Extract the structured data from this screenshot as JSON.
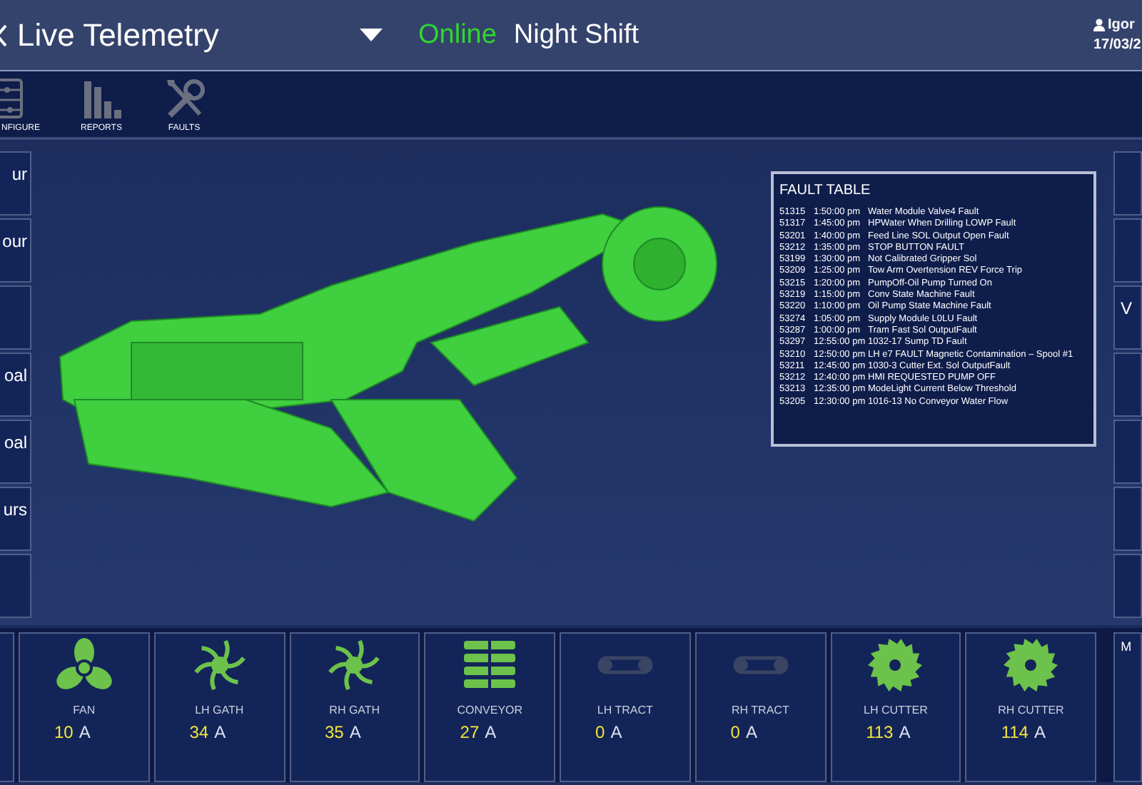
{
  "header": {
    "title": "Live Telemetry",
    "connection": "Online",
    "shift": "Night Shift",
    "user": "Igor",
    "date": "17/03/2"
  },
  "toolbar": [
    {
      "kind": "configure",
      "label": "NFIGURE"
    },
    {
      "kind": "reports",
      "label": "REPORTS"
    },
    {
      "kind": "faults",
      "label": "FAULTS"
    }
  ],
  "left_buttons": [
    {
      "kind": "text",
      "label": "ur"
    },
    {
      "kind": "text",
      "label": "our"
    },
    {
      "kind": "blank"
    },
    {
      "kind": "text",
      "label": "oal"
    },
    {
      "kind": "text",
      "label": "oal"
    },
    {
      "kind": "text",
      "label": "urs"
    },
    {
      "kind": "blank"
    }
  ],
  "right_buttons": [
    {
      "kind": "blank"
    },
    {
      "kind": "blank"
    },
    {
      "kind": "text",
      "label": "V"
    },
    {
      "kind": "blank"
    },
    {
      "kind": "blank"
    },
    {
      "kind": "blank"
    },
    {
      "kind": "blank"
    }
  ],
  "fault_table": {
    "title": "FAULT TABLE",
    "rows": [
      {
        "code": "51315",
        "time": "1:50:00 pm",
        "description": "Water Module Valve4 Fault"
      },
      {
        "code": "51317",
        "time": "1:45:00 pm",
        "description": "HPWater When Drilling LOWP Fault"
      },
      {
        "code": "53201",
        "time": "1:40:00 pm",
        "description": "Feed Line SOL Output Open Fault"
      },
      {
        "code": "53212",
        "time": "1:35:00 pm",
        "description": "STOP BUTTON FAULT"
      },
      {
        "code": "53199",
        "time": "1:30:00 pm",
        "description": "Not Calibrated Gripper Sol"
      },
      {
        "code": "53209",
        "time": "1:25:00 pm",
        "description": "Tow Arm Overtension REV Force Trip"
      },
      {
        "code": "53215",
        "time": "1:20:00 pm",
        "description": "PumpOff-Oil Pump Turned On"
      },
      {
        "code": "53219",
        "time": "1:15:00 pm",
        "description": "Conv State Machine Fault"
      },
      {
        "code": "53220",
        "time": "1:10:00 pm",
        "description": "Oil Pump State Machine Fault"
      },
      {
        "code": "53274",
        "time": "1:05:00 pm",
        "description": "Supply Module L0LU Fault"
      },
      {
        "code": "53287",
        "time": "1:00:00 pm",
        "description": "Tram Fast Sol OutputFault"
      },
      {
        "code": "53297",
        "time": "12:55:00 pm",
        "description": "1032-17 Sump TD Fault"
      },
      {
        "code": "53210",
        "time": "12:50:00 pm",
        "description": "LH e7 FAULT Magnetic Contamination – Spool #1"
      },
      {
        "code": "53211",
        "time": "12:45:00 pm",
        "description": "1030-3 Cutter Ext. Sol OutputFault"
      },
      {
        "code": "53212",
        "time": "12:40:00 pm",
        "description": "HMI REQUESTED PUMP OFF"
      },
      {
        "code": "53213",
        "time": "12:35:00 pm",
        "description": "ModeLight Current Below Threshold"
      },
      {
        "code": "53205",
        "time": "12:30:00 pm",
        "description": "1016-13 No Conveyor Water Flow"
      }
    ]
  },
  "motors": [
    {
      "kind": "fan",
      "label": "FAN",
      "value": "10",
      "unit": "A",
      "active": true
    },
    {
      "kind": "gatherer",
      "label": "LH GATH",
      "value": "34",
      "unit": "A",
      "active": true
    },
    {
      "kind": "gatherer",
      "label": "RH GATH",
      "value": "35",
      "unit": "A",
      "active": true
    },
    {
      "kind": "conveyor",
      "label": "CONVEYOR",
      "value": "27",
      "unit": "A",
      "active": true
    },
    {
      "kind": "track",
      "label": "LH TRACT",
      "value": "0",
      "unit": "A",
      "active": false
    },
    {
      "kind": "track",
      "label": "RH TRACT",
      "value": "0",
      "unit": "A",
      "active": false
    },
    {
      "kind": "cutter",
      "label": "LH CUTTER",
      "value": "113",
      "unit": "A",
      "active": true
    },
    {
      "kind": "cutter",
      "label": "RH CUTTER",
      "value": "114",
      "unit": "A",
      "active": true
    }
  ],
  "right_tile": {
    "label": "M"
  }
}
